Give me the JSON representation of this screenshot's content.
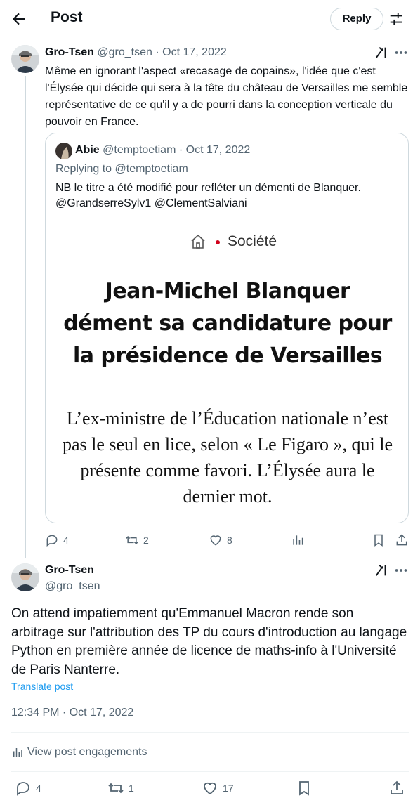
{
  "header": {
    "title": "Post",
    "reply_label": "Reply"
  },
  "thread_tweet": {
    "author_name": "Gro-Tsen",
    "handle": "@gro_tsen",
    "separator": "·",
    "date": "Oct 17, 2022",
    "text": "Même en ignorant l'aspect «recasage de copains», l'idée que c'est l'Élysée qui décide qui sera à la tête du château de Versailles me semble représentative de ce qu'il y a de pourri dans la conception verticale du pouvoir en France.",
    "quote": {
      "author_name": "Abie",
      "handle": "@temptoetiam",
      "date": "Oct 17, 2022",
      "replying_prefix": "Replying to",
      "replying_to": "@temptoetiam",
      "text": "NB le titre a été modifié pour refléter un démenti de Blanquer. @GrandserreSylv1 @ClementSalviani",
      "article": {
        "section": "Société",
        "headline": "Jean-Michel Blanquer dément sa candidature pour la présidence de Versailles",
        "lede": "L’ex-ministre de l’Éducation nationale n’est pas le seul en lice, selon « Le Figaro », qui le présente comme favori. L’Élysée aura le dernier mot."
      }
    },
    "stats": {
      "replies": "4",
      "reposts": "2",
      "likes": "8"
    }
  },
  "main_tweet": {
    "author_name": "Gro-Tsen",
    "handle": "@gro_tsen",
    "text": "On attend impatiemment qu'Emmanuel Macron rende son arbitrage sur l'attribution des TP du cours d'introduction au langage Python en première année de licence de maths-info à l'Université de Paris Nanterre.",
    "translate_label": "Translate post",
    "timestamp": "12:34 PM · Oct 17, 2022",
    "engagements_label": "View post engagements",
    "stats": {
      "replies": "4",
      "reposts": "1",
      "likes": "17"
    }
  },
  "icons": {
    "back": "arrow-left-icon",
    "tune": "sliders-icon",
    "grok": "grok-icon",
    "more": "more-dots-icon",
    "reply": "speech-bubble-icon",
    "repost": "repost-arrows-icon",
    "like": "heart-icon",
    "views": "bar-chart-icon",
    "bookmark": "bookmark-icon",
    "share": "share-upload-icon",
    "home": "house-icon"
  },
  "colors": {
    "link": "#1d9bf0",
    "muted": "#536471",
    "border": "#cfd9de",
    "section_dot": "#d0021b"
  }
}
